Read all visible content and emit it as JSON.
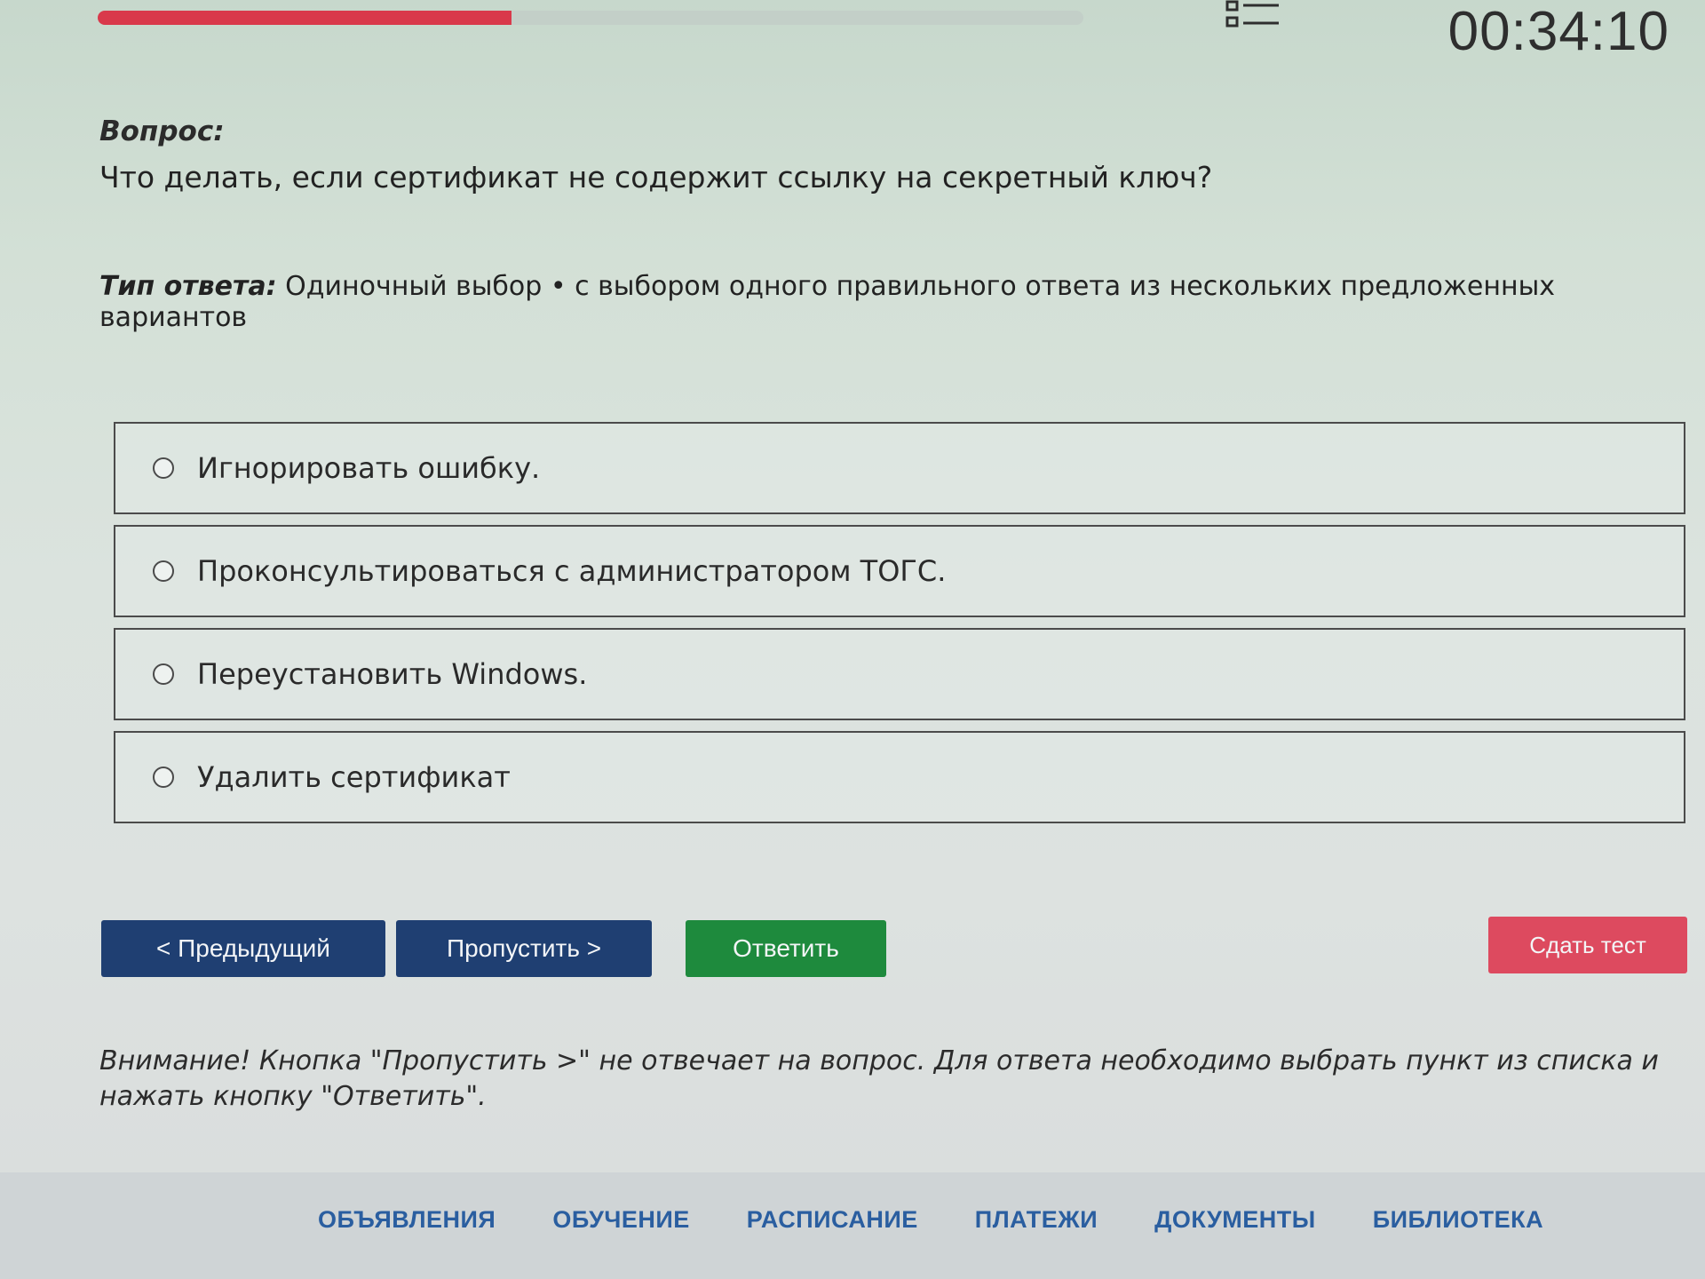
{
  "progress": {
    "fraction": 0.42,
    "fill_color": "#d9394b"
  },
  "header": {
    "timer": "00:34:10",
    "list_icon": "list-icon"
  },
  "question": {
    "heading": "Вопрос:",
    "text": "Что делать, если сертификат не содержит ссылку на секретный ключ?",
    "answer_type_label": "Тип ответа:",
    "answer_type_value": "Одиночный выбор • с выбором одного правильного ответа из нескольких предложенных вариантов"
  },
  "options": [
    {
      "label": "Игнорировать ошибку."
    },
    {
      "label": "Проконсультироваться с администратором ТОГС."
    },
    {
      "label": "Переустановить Windows."
    },
    {
      "label": "Удалить сертификат"
    }
  ],
  "buttons": {
    "prev": "< Предыдущий",
    "skip": "Пропустить >",
    "answer": "Ответить",
    "submit": "Сдать тест"
  },
  "colors": {
    "primary": "#1f3f72",
    "success": "#1e8a3d",
    "danger": "#dd4a5f",
    "nav_link": "#2a5ea0"
  },
  "warning": "Внимание! Кнопка \"Пропустить >\" не отвечает на вопрос. Для ответа необходимо выбрать пункт из списка и нажать кнопку \"Ответить\".",
  "footer": {
    "nav": [
      "ОБЪЯВЛЕНИЯ",
      "ОБУЧЕНИЕ",
      "РАСПИСАНИЕ",
      "ПЛАТЕЖИ",
      "ДОКУМЕНТЫ",
      "БИБЛИОТЕКА"
    ]
  }
}
